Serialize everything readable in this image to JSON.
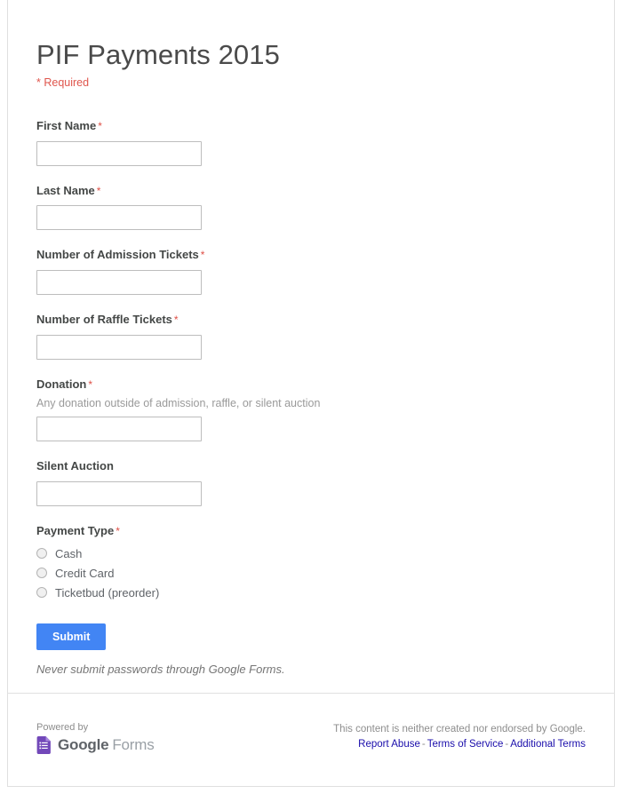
{
  "form": {
    "title": "PIF Payments 2015",
    "required_note": "* Required",
    "required_marker": "*",
    "fields": [
      {
        "label": "First Name",
        "required": true,
        "help": "",
        "type": "text",
        "value": "",
        "name": "first-name"
      },
      {
        "label": "Last Name",
        "required": true,
        "help": "",
        "type": "text",
        "value": "",
        "name": "last-name"
      },
      {
        "label": "Number of Admission Tickets",
        "required": true,
        "help": "",
        "type": "text",
        "value": "",
        "name": "number-of-admission-tickets"
      },
      {
        "label": "Number of Raffle Tickets",
        "required": true,
        "help": "",
        "type": "text",
        "value": "",
        "name": "number-of-raffle-tickets"
      },
      {
        "label": "Donation",
        "required": true,
        "help": "Any donation outside of admission, raffle, or silent auction",
        "type": "text",
        "value": "",
        "name": "donation"
      },
      {
        "label": "Silent Auction",
        "required": false,
        "help": "",
        "type": "text",
        "value": "",
        "name": "silent-auction"
      }
    ],
    "payment_type": {
      "label": "Payment Type",
      "required": true,
      "options": [
        {
          "label": "Cash",
          "selected": false
        },
        {
          "label": "Credit Card",
          "selected": false
        },
        {
          "label": "Ticketbud (preorder)",
          "selected": false
        }
      ]
    },
    "submit_label": "Submit",
    "password_disclaimer": "Never submit passwords through Google Forms."
  },
  "footer": {
    "powered_by": "Powered by",
    "brand_primary": "Google",
    "brand_secondary": "Forms",
    "endorsement": "This content is neither created nor endorsed by Google.",
    "links": [
      {
        "label": "Report Abuse"
      },
      {
        "label": "Terms of Service"
      },
      {
        "label": "Additional Terms"
      }
    ],
    "link_separator": "-"
  },
  "colors": {
    "accent_blue": "#4285f4",
    "required_red": "#d93025",
    "link_blue": "#1a0dab",
    "forms_purple": "#7248b9",
    "label_gray": "#444746",
    "title_gray": "#4a4a4a"
  }
}
